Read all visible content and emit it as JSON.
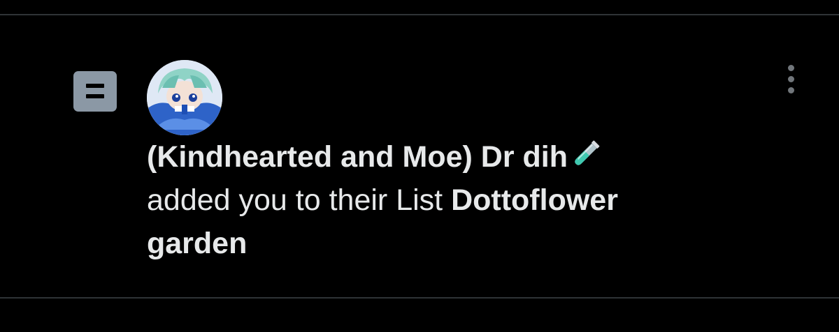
{
  "notification": {
    "type": "list-added",
    "user_name": "(Kindhearted and Moe) Dr dih",
    "user_name_emoji": "test-tube-icon",
    "action_text": "added you to their List",
    "list_name_part1": "Dottoflower",
    "list_name_part2": "garden",
    "icon": "list-icon",
    "menu_icon": "more-vertical-icon"
  },
  "colors": {
    "background": "#000000",
    "divider": "#2f3336",
    "text": "#e7e9ea",
    "list_icon_bg": "#8b98a5",
    "menu_dots": "#71767b"
  }
}
